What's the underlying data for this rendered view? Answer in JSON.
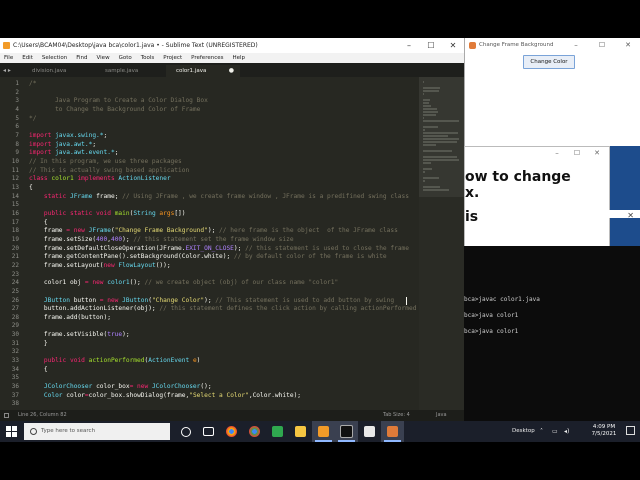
{
  "sublime": {
    "title": "C:\\Users\\BCAM04\\Desktop\\java bca\\color1.java • - Sublime Text (UNREGISTERED)",
    "menu": [
      "File",
      "Edit",
      "Selection",
      "Find",
      "View",
      "Goto",
      "Tools",
      "Project",
      "Preferences",
      "Help"
    ],
    "tabs": [
      {
        "label": "division.java"
      },
      {
        "label": "sample.java"
      },
      {
        "label": "color1.java"
      }
    ],
    "lines": [
      [
        [
          "/*",
          "c"
        ]
      ],
      [
        [
          "",
          "t"
        ]
      ],
      [
        [
          "       Java Program to Create a Color Dialog Box",
          "c"
        ]
      ],
      [
        [
          "       to Change the Background Color of Frame",
          "c"
        ]
      ],
      [
        [
          "*/",
          "c"
        ]
      ],
      [
        [
          "",
          "t"
        ]
      ],
      [
        [
          "import ",
          "k"
        ],
        [
          "javax.swing.*",
          "i"
        ],
        [
          ";",
          "t"
        ]
      ],
      [
        [
          "import ",
          "k"
        ],
        [
          "java.awt.*",
          "i"
        ],
        [
          ";",
          "t"
        ]
      ],
      [
        [
          "import ",
          "k"
        ],
        [
          "java.awt.event.*",
          "i"
        ],
        [
          ";",
          "t"
        ]
      ],
      [
        [
          "// In this program, we use three packages",
          "c"
        ]
      ],
      [
        [
          "// This is actually swing based application",
          "c"
        ]
      ],
      [
        [
          "class ",
          "k"
        ],
        [
          "color1 ",
          "g"
        ],
        [
          "implements ",
          "k"
        ],
        [
          "ActionListener",
          "i"
        ]
      ],
      [
        [
          "{",
          "t"
        ]
      ],
      [
        [
          "    static ",
          "k"
        ],
        [
          "JFrame ",
          "i"
        ],
        [
          "frame; ",
          "t"
        ],
        [
          "// Using JFrame , we create frame window , JFrame is a predifined swing class",
          "c"
        ]
      ],
      [
        [
          "",
          "t"
        ]
      ],
      [
        [
          "    public static void ",
          "k"
        ],
        [
          "main",
          "g"
        ],
        [
          "(",
          "t"
        ],
        [
          "String ",
          "i"
        ],
        [
          "args",
          "o"
        ],
        [
          "[])",
          "t"
        ]
      ],
      [
        [
          "    {",
          "t"
        ]
      ],
      [
        [
          "    frame ",
          "t"
        ],
        [
          "= ",
          "k"
        ],
        [
          "new ",
          "k"
        ],
        [
          "JFrame",
          "i"
        ],
        [
          "(",
          "t"
        ],
        [
          "\"Change Frame Background\"",
          "s"
        ],
        [
          "); ",
          "t"
        ],
        [
          "// here frame is the object  of the JFrame class",
          "c"
        ]
      ],
      [
        [
          "    frame.setSize(",
          "t"
        ],
        [
          "400",
          "p"
        ],
        [
          ",",
          "t"
        ],
        [
          "400",
          "p"
        ],
        [
          "); ",
          "t"
        ],
        [
          "// this statement set the frame window size",
          "c"
        ]
      ],
      [
        [
          "    frame.setDefaultCloseOperation(JFrame.",
          "t"
        ],
        [
          "EXIT_ON_CLOSE",
          "p"
        ],
        [
          "); ",
          "t"
        ],
        [
          "// this statement is used to close the frame",
          "c"
        ]
      ],
      [
        [
          "    frame.getContentPane().setBackground(Color.",
          "t"
        ],
        [
          "white",
          "t"
        ],
        [
          "); ",
          "t"
        ],
        [
          "// by default color of the frame is white",
          "c"
        ]
      ],
      [
        [
          "    frame.setLayout(",
          "t"
        ],
        [
          "new ",
          "k"
        ],
        [
          "FlowLayout",
          "i"
        ],
        [
          "());",
          "t"
        ]
      ],
      [
        [
          "",
          "t"
        ]
      ],
      [
        [
          "    color1 obj ",
          "t"
        ],
        [
          "= ",
          "k"
        ],
        [
          "new ",
          "k"
        ],
        [
          "color1",
          "i"
        ],
        [
          "(); ",
          "t"
        ],
        [
          "// we create object (obj) of our class name \"color1\"",
          "c"
        ]
      ],
      [
        [
          "",
          "t"
        ]
      ],
      [
        [
          "    JButton ",
          "i"
        ],
        [
          "button ",
          "t"
        ],
        [
          "= ",
          "k"
        ],
        [
          "new ",
          "k"
        ],
        [
          "JButton",
          "i"
        ],
        [
          "(",
          "t"
        ],
        [
          "\"Change Color\"",
          "s"
        ],
        [
          "); ",
          "t"
        ],
        [
          "// This statement is used to add button by swing",
          "c"
        ]
      ],
      [
        [
          "    button.addActionListener(obj); ",
          "t"
        ],
        [
          "// this statement defines the click action by calling actionPerformed",
          "c"
        ]
      ],
      [
        [
          "    frame.add(button);",
          "t"
        ]
      ],
      [
        [
          "",
          "t"
        ]
      ],
      [
        [
          "    frame.setVisible(",
          "t"
        ],
        [
          "true",
          "p"
        ],
        [
          ");",
          "t"
        ]
      ],
      [
        [
          "    }",
          "t"
        ]
      ],
      [
        [
          "",
          "t"
        ]
      ],
      [
        [
          "    public void ",
          "k"
        ],
        [
          "actionPerformed",
          "g"
        ],
        [
          "(",
          "t"
        ],
        [
          "ActionEvent ",
          "i"
        ],
        [
          "e",
          "o"
        ],
        [
          ")",
          "t"
        ]
      ],
      [
        [
          "    {",
          "t"
        ]
      ],
      [
        [
          "",
          "t"
        ]
      ],
      [
        [
          "    JColorChooser ",
          "i"
        ],
        [
          "color_box",
          "t"
        ],
        [
          "= ",
          "k"
        ],
        [
          "new ",
          "k"
        ],
        [
          "JColorChooser",
          "i"
        ],
        [
          "();",
          "t"
        ]
      ],
      [
        [
          "    Color ",
          "i"
        ],
        [
          "color",
          "t"
        ],
        [
          "=",
          "k"
        ],
        [
          "color_box.showDialog(frame,",
          "t"
        ],
        [
          "\"Select a Color\"",
          "s"
        ],
        [
          ",Color.",
          "t"
        ],
        [
          "white",
          "t"
        ],
        [
          ");",
          "t"
        ]
      ],
      [
        [
          "",
          "t"
        ]
      ]
    ],
    "status_left": "Line 26, Column 82",
    "status_tab_size": "Tab Size: 4",
    "status_syntax": "Java"
  },
  "frame_window": {
    "title": "Change Frame Background",
    "button_label": "Change Color"
  },
  "dialog_behind": {
    "line1": "ow to change",
    "line2": "x.",
    "line3": "is"
  },
  "terminal": {
    "lines": [
      "bca>javac color1.java",
      "bca>java color1",
      "bca>java color1"
    ]
  },
  "taskbar": {
    "search_placeholder": "Type here to search",
    "tray_label": "Desktop",
    "time": "4:09 PM",
    "date": "7/5/2021"
  },
  "colors": {
    "keyword": "#f92672",
    "type": "#66d9ef",
    "function": "#a6e22e",
    "string": "#e6db74",
    "comment": "#75715e",
    "number": "#ae81ff",
    "param": "#fd971f",
    "text": "#f8f8f2",
    "editor_bg": "#272822"
  }
}
